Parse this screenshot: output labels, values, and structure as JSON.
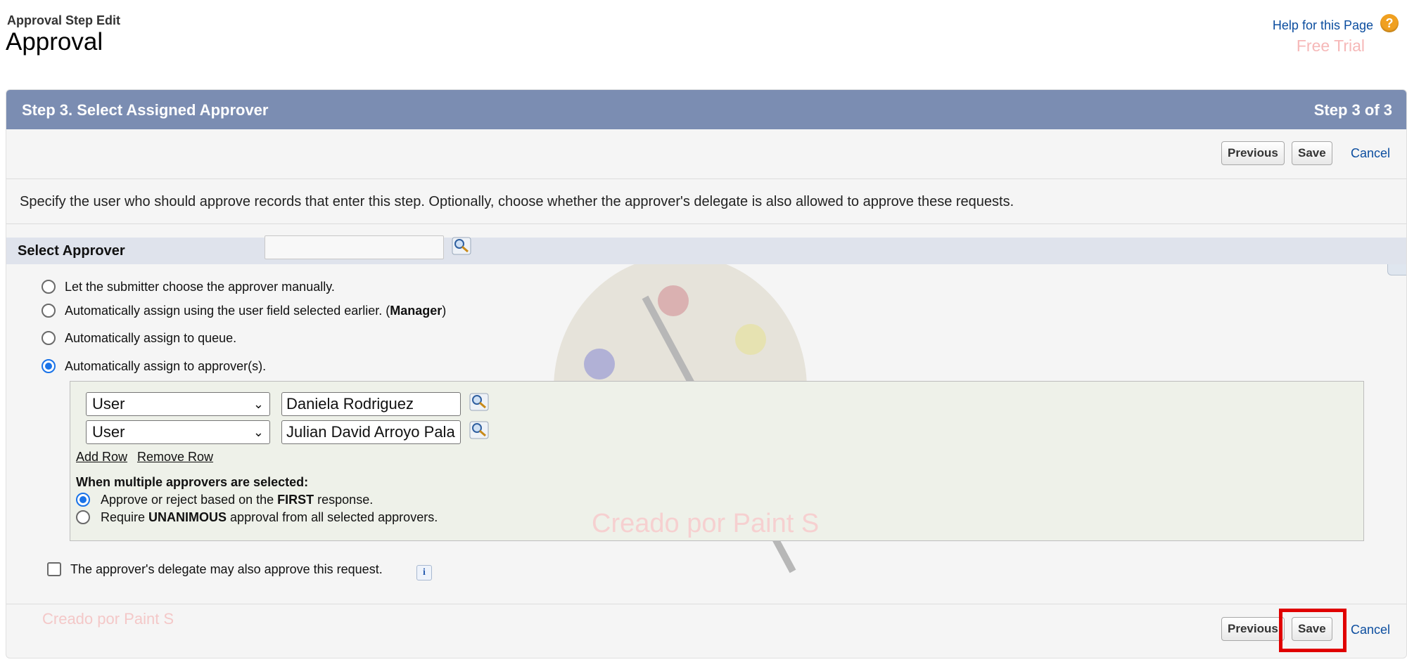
{
  "header": {
    "page_type": "Approval Step Edit",
    "page_title": "Approval",
    "help_link": "Help for this Page",
    "help_icon_glyph": "?",
    "free_trial": "Free Trial"
  },
  "panel": {
    "title": "Step 3. Select Assigned Approver",
    "step_indicator": "Step 3 of 3",
    "buttons": {
      "previous": "Previous",
      "save": "Save",
      "cancel": "Cancel"
    },
    "instructions": "Specify the user who should approve records that enter this step. Optionally, choose whether the approver's delegate is also allowed to approve these requests."
  },
  "select_approver": {
    "section_title": "Select Approver",
    "options": [
      {
        "label": "Let the submitter choose the approver manually.",
        "selected": false
      },
      {
        "label_prefix": "Automatically assign using the user field selected earlier. (",
        "label_bold": "Manager",
        "label_suffix": ")",
        "selected": false
      },
      {
        "label": "Automatically assign to queue.",
        "selected": false
      },
      {
        "label": "Automatically assign to approver(s).",
        "selected": true
      }
    ],
    "approvers": [
      {
        "type": "User",
        "name": "Daniela Rodriguez"
      },
      {
        "type": "User",
        "name": "Julian David Arroyo Pala"
      }
    ],
    "add_row": "Add Row",
    "remove_row": "Remove Row",
    "multi_title": "When multiple approvers are selected:",
    "multi_options": [
      {
        "prefix": "Approve or reject based on the ",
        "bold": "FIRST",
        "suffix": " response.",
        "selected": true
      },
      {
        "prefix": "Require ",
        "bold": "UNANIMOUS",
        "suffix": " approval from all selected approvers.",
        "selected": false
      }
    ],
    "delegate_label": "The approver's delegate may also approve this request.",
    "delegate_checked": false,
    "info_glyph": "i"
  },
  "watermarks": {
    "center": "Creado por Paint S",
    "bottom_left": "Creado por Paint S"
  },
  "colors": {
    "header_bar": "#7b8db2",
    "link": "#0b4d9f",
    "highlight": "#e00000",
    "approver_box": "#eef1e9"
  }
}
